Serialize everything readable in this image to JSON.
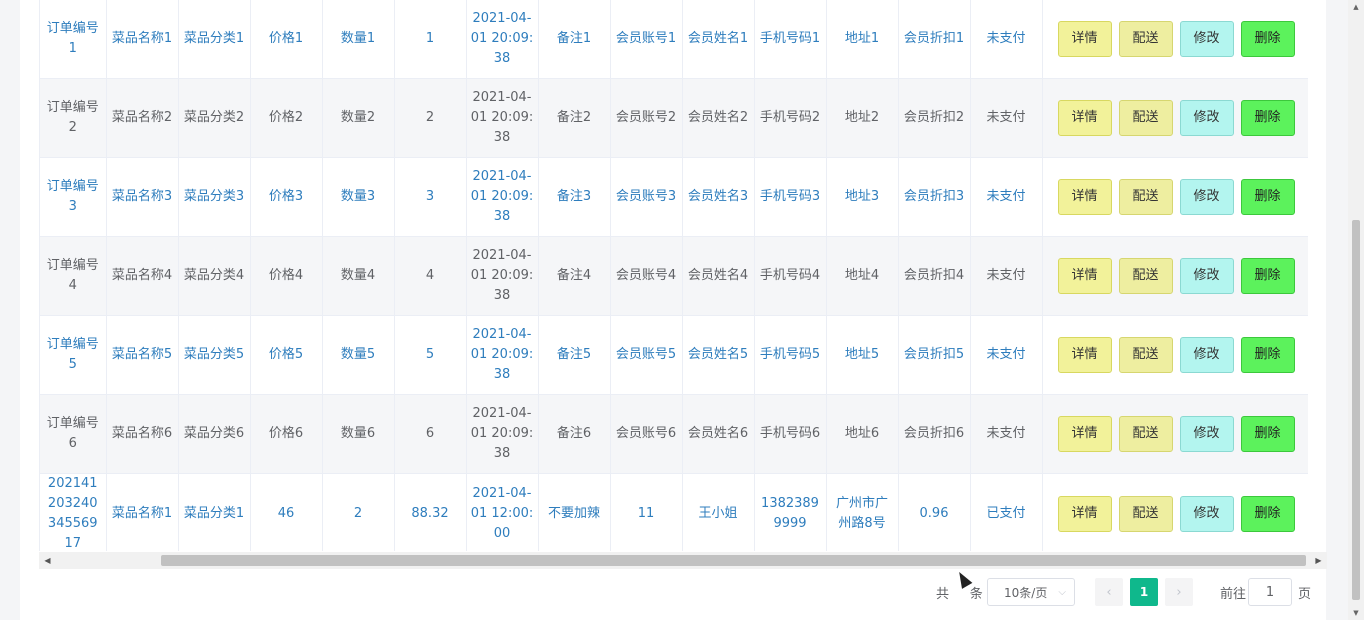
{
  "buttons": {
    "detail": "详情",
    "deliver": "配送",
    "edit": "修改",
    "delete": "删除"
  },
  "rows": [
    {
      "order_no": "订单编号1",
      "dish_name": "菜品名称1",
      "dish_category": "菜品分类1",
      "price": "价格1",
      "quantity": "数量1",
      "total": "1",
      "time": "2021-04-01 20:09:38",
      "remark": "备注1",
      "member_account": "会员账号1",
      "member_name": "会员姓名1",
      "phone": "手机号码1",
      "address": "地址1",
      "discount": "会员折扣1",
      "pay_status": "未支付"
    },
    {
      "order_no": "订单编号2",
      "dish_name": "菜品名称2",
      "dish_category": "菜品分类2",
      "price": "价格2",
      "quantity": "数量2",
      "total": "2",
      "time": "2021-04-01 20:09:38",
      "remark": "备注2",
      "member_account": "会员账号2",
      "member_name": "会员姓名2",
      "phone": "手机号码2",
      "address": "地址2",
      "discount": "会员折扣2",
      "pay_status": "未支付"
    },
    {
      "order_no": "订单编号3",
      "dish_name": "菜品名称3",
      "dish_category": "菜品分类3",
      "price": "价格3",
      "quantity": "数量3",
      "total": "3",
      "time": "2021-04-01 20:09:38",
      "remark": "备注3",
      "member_account": "会员账号3",
      "member_name": "会员姓名3",
      "phone": "手机号码3",
      "address": "地址3",
      "discount": "会员折扣3",
      "pay_status": "未支付"
    },
    {
      "order_no": "订单编号4",
      "dish_name": "菜品名称4",
      "dish_category": "菜品分类4",
      "price": "价格4",
      "quantity": "数量4",
      "total": "4",
      "time": "2021-04-01 20:09:38",
      "remark": "备注4",
      "member_account": "会员账号4",
      "member_name": "会员姓名4",
      "phone": "手机号码4",
      "address": "地址4",
      "discount": "会员折扣4",
      "pay_status": "未支付"
    },
    {
      "order_no": "订单编号5",
      "dish_name": "菜品名称5",
      "dish_category": "菜品分类5",
      "price": "价格5",
      "quantity": "数量5",
      "total": "5",
      "time": "2021-04-01 20:09:38",
      "remark": "备注5",
      "member_account": "会员账号5",
      "member_name": "会员姓名5",
      "phone": "手机号码5",
      "address": "地址5",
      "discount": "会员折扣5",
      "pay_status": "未支付"
    },
    {
      "order_no": "订单编号6",
      "dish_name": "菜品名称6",
      "dish_category": "菜品分类6",
      "price": "价格6",
      "quantity": "数量6",
      "total": "6",
      "time": "2021-04-01 20:09:38",
      "remark": "备注6",
      "member_account": "会员账号6",
      "member_name": "会员姓名6",
      "phone": "手机号码6",
      "address": "地址6",
      "discount": "会员折扣6",
      "pay_status": "未支付"
    },
    {
      "order_no": "20214120324034556917",
      "dish_name": "菜品名称1",
      "dish_category": "菜品分类1",
      "price": "46",
      "quantity": "2",
      "total": "88.32",
      "time": "2021-04-01 12:00:00",
      "remark": "不要加辣",
      "member_account": "11",
      "member_name": "王小姐",
      "phone": "13823899999",
      "address": "广州市广州路8号",
      "discount": "0.96",
      "pay_status": "已支付"
    }
  ],
  "pagination": {
    "total_prefix": "共",
    "total_suffix": "条",
    "page_size": "10条/页",
    "current_page": "1",
    "goto_label": "前往",
    "goto_value": "1",
    "page_label": "页"
  },
  "colors": {
    "link_text": "#2e7dbd",
    "active_page": "#0fb88c",
    "delete_button": "#5cf25c",
    "edit_button": "#b3f5ef",
    "detail_button": "#f2f29a"
  }
}
